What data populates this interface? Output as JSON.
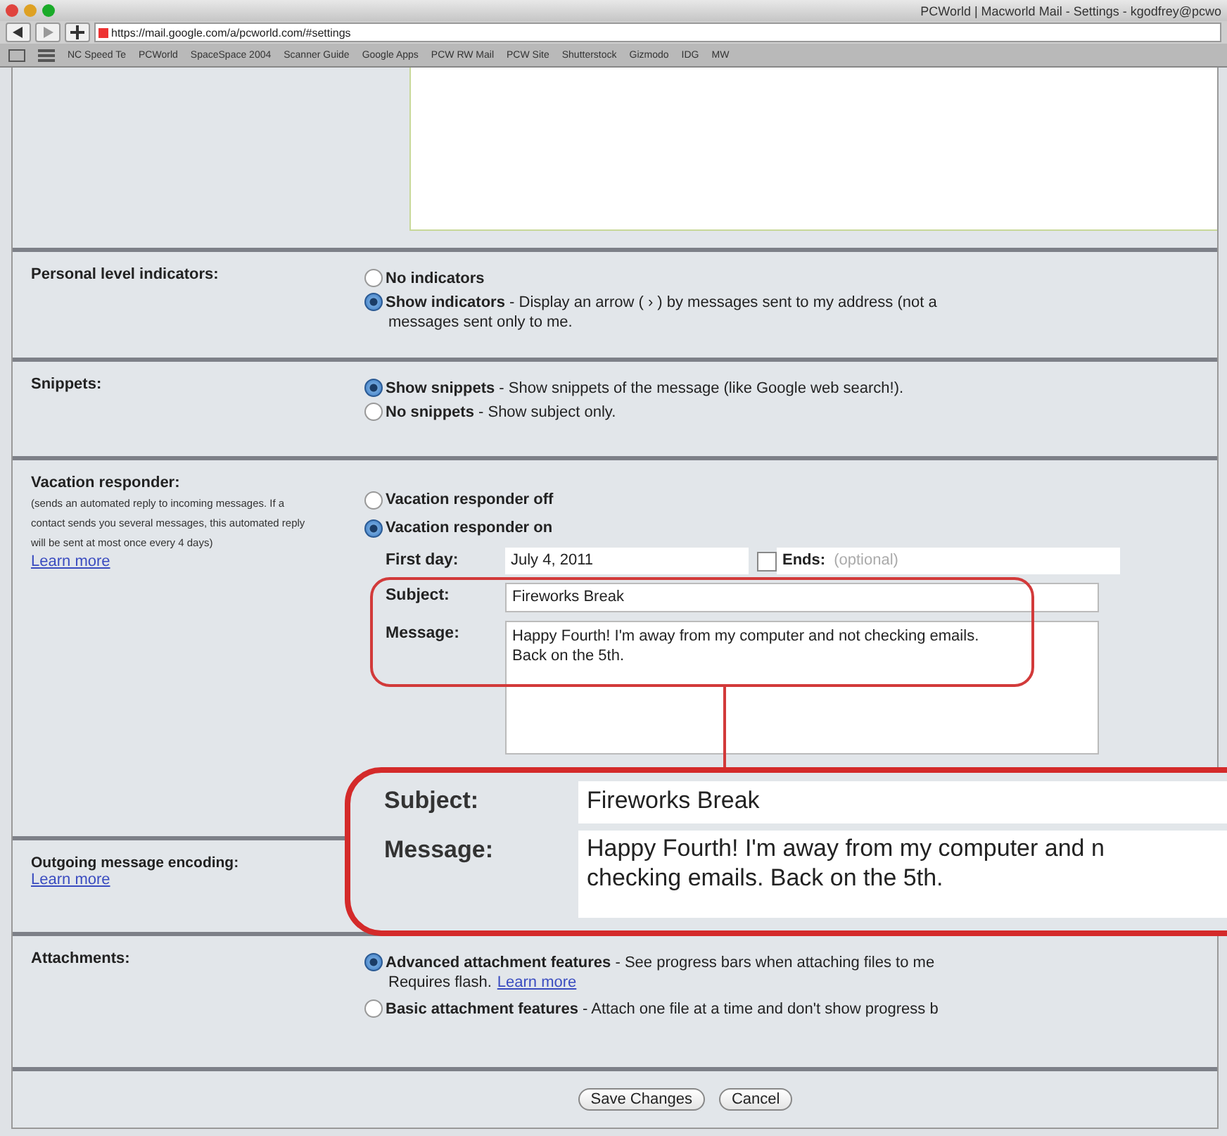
{
  "browser": {
    "title": "PCWorld | Macworld Mail - Settings - kgodfrey@pcwo",
    "url": "https://mail.google.com/a/pcworld.com/#settings",
    "bookmarks": [
      "NC Speed Te",
      "PCWorld",
      "SpaceSpace 2004",
      "Scanner Guide",
      "Google Apps",
      "PCW RW Mail",
      "PCW Site",
      "Shutterstock",
      "Gizmodo",
      "IDG",
      "MW"
    ]
  },
  "personal_indicators": {
    "label": "Personal level indicators:",
    "options": [
      {
        "label": "No indicators",
        "selected": false
      },
      {
        "label": "Show indicators",
        "description": " - Display an arrow ( › ) by messages sent to my address (not a",
        "continuation": "messages sent only to me.",
        "selected": true
      }
    ]
  },
  "snippets": {
    "label": "Snippets:",
    "options": [
      {
        "label": "Show snippets",
        "description": " - Show snippets of the message (like Google web search!).",
        "selected": true
      },
      {
        "label": "No snippets",
        "description": " - Show subject only.",
        "selected": false
      }
    ]
  },
  "vacation": {
    "label": "Vacation responder:",
    "note": "(sends an automated reply to incoming messages. If a contact sends you several messages, this automated reply will be sent at most once every 4 days)",
    "link": "Learn more",
    "options": [
      {
        "label": "Vacation responder off",
        "selected": false
      },
      {
        "label": "Vacation responder on",
        "selected": true
      }
    ],
    "first_day_label": "First day:",
    "first_day": "July 4, 2011",
    "ends_checked": false,
    "ends_label": "Ends:",
    "ends_placeholder": "(optional)",
    "subject_label": "Subject:",
    "subject": "Fireworks Break",
    "message_label": "Message:",
    "message": "Happy Fourth! I'm away from my computer and not checking emails. Back on the 5th."
  },
  "outgoing": {
    "label": "Outgoing message encoding:",
    "link": "Learn more"
  },
  "attachments": {
    "label": "Attachments:",
    "options": [
      {
        "label": "Advanced attachment features",
        "description": " - See progress bars when attaching files to me",
        "continuation": "Requires flash.",
        "link": "Learn more",
        "selected": true
      },
      {
        "label": "Basic attachment features",
        "description": " - Attach one file at a time and don't show progress b",
        "selected": false
      }
    ]
  },
  "callout": {
    "subject_label": "Subject:",
    "subject": "Fireworks Break",
    "message_label": "Message:",
    "message_line1": "Happy Fourth! I'm away from my computer and n",
    "message_line2": "checking emails. Back on the 5th."
  },
  "buttons": [
    "Save Changes",
    "Cancel"
  ]
}
